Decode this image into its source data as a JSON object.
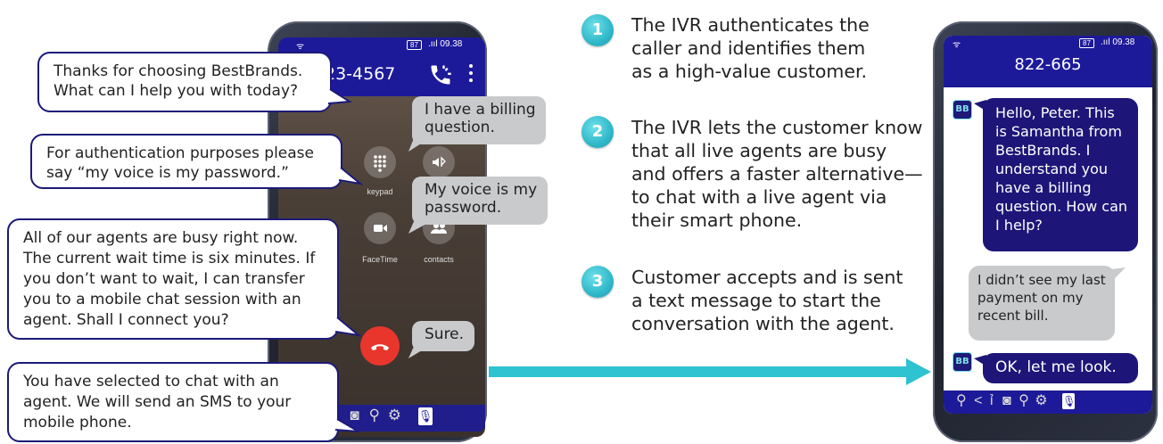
{
  "left_phone": {
    "status_battery": "87",
    "status_time": ".ııl 09.38",
    "number": "23-4567",
    "keypad_label": "keypad",
    "facetime_label": "FaceTime",
    "contacts_label": "contacts"
  },
  "ivr_bubbles": [
    "Thanks for choosing BestBrands. What can I help you with today?",
    "For authentication purposes please say “my voice is my password.”",
    "All of our agents are busy right now. The current wait time is six minutes. If you don’t want to wait, I can transfer you to a mobile chat session with an agent. Shall I connect you?",
    "You have selected to chat with an agent. We will send an SMS to your mobile phone."
  ],
  "caller_bubbles": [
    "I have a billing question.",
    "My voice is my password.",
    "Sure."
  ],
  "steps": [
    {
      "num": "1",
      "text": "The IVR authenticates the caller and identifies them as a high-value customer."
    },
    {
      "num": "2",
      "text": "The IVR lets the customer know that all live agents are busy and offers a faster alternative—to chat with a live agent via their smart phone."
    },
    {
      "num": "3",
      "text": "Customer accepts and is sent a text message to start the conversation with the agent."
    }
  ],
  "right_phone": {
    "status_battery": "87",
    "status_time": ".ııl 09.38",
    "number": "822-665",
    "agent_badge": "BB",
    "messages": [
      {
        "from": "agent",
        "text": "Hello, Peter. This is Samantha from BestBrands. I understand you have a billing question. How can I help?"
      },
      {
        "from": "customer",
        "text": "I didn’t see my last payment on my recent bill."
      },
      {
        "from": "agent",
        "text": "OK, let me look."
      }
    ]
  },
  "colors": {
    "navy": "#1d1a78",
    "teal": "#2fb8c9",
    "hangup": "#e8362d",
    "gray_bubble": "#c9cacc"
  },
  "icons": {
    "call": "phone-icon",
    "menu": "more-vertical-icon",
    "keypad": "keypad-grid-icon",
    "mute": "bluetooth-speaker-icon",
    "facetime": "video-camera-icon",
    "contacts": "contacts-icon",
    "hangup": "hangup-phone-icon",
    "dock": [
      "search-icon",
      "share-icon",
      "people-icon",
      "camera-icon",
      "location-pin-icon",
      "settings-icon",
      "microphone-icon"
    ]
  }
}
